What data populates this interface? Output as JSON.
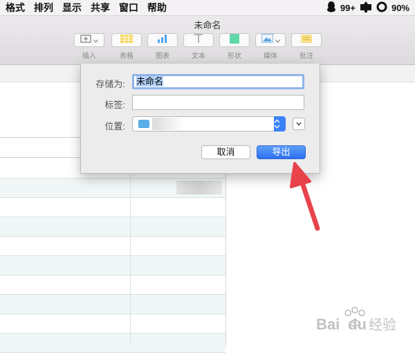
{
  "menubar": {
    "items": [
      {
        "label": "格式"
      },
      {
        "label": "排列"
      },
      {
        "label": "显示"
      },
      {
        "label": "共享"
      },
      {
        "label": "窗口"
      },
      {
        "label": "帮助"
      }
    ],
    "status": {
      "notification_count": "99+",
      "battery_percent": "90%",
      "icons": [
        "qq-penguin-icon",
        "notification-bell-icon",
        "battery-ring-icon"
      ]
    }
  },
  "window": {
    "title": "未命名",
    "toolbar": [
      {
        "label": "插入",
        "icon": "insert-icon"
      },
      {
        "label": "表格",
        "icon": "table-icon"
      },
      {
        "label": "图表",
        "icon": "chart-icon"
      },
      {
        "label": "文本",
        "icon": "text-icon"
      },
      {
        "label": "形状",
        "icon": "shape-icon"
      },
      {
        "label": "媒体",
        "icon": "media-icon"
      },
      {
        "label": "批注",
        "icon": "comment-icon"
      }
    ]
  },
  "dialog": {
    "save_as_label": "存储为:",
    "save_as_value": "未命名",
    "tags_label": "标签:",
    "tags_value": "",
    "location_label": "位置:",
    "cancel_label": "取消",
    "export_label": "导出"
  },
  "colors": {
    "accent": "#2c6ff1",
    "selection": "#b4d3fb",
    "arrow": "#e8434b",
    "row_alt": "#f1f7f7"
  },
  "watermark": {
    "text": "Baidu 经验"
  }
}
